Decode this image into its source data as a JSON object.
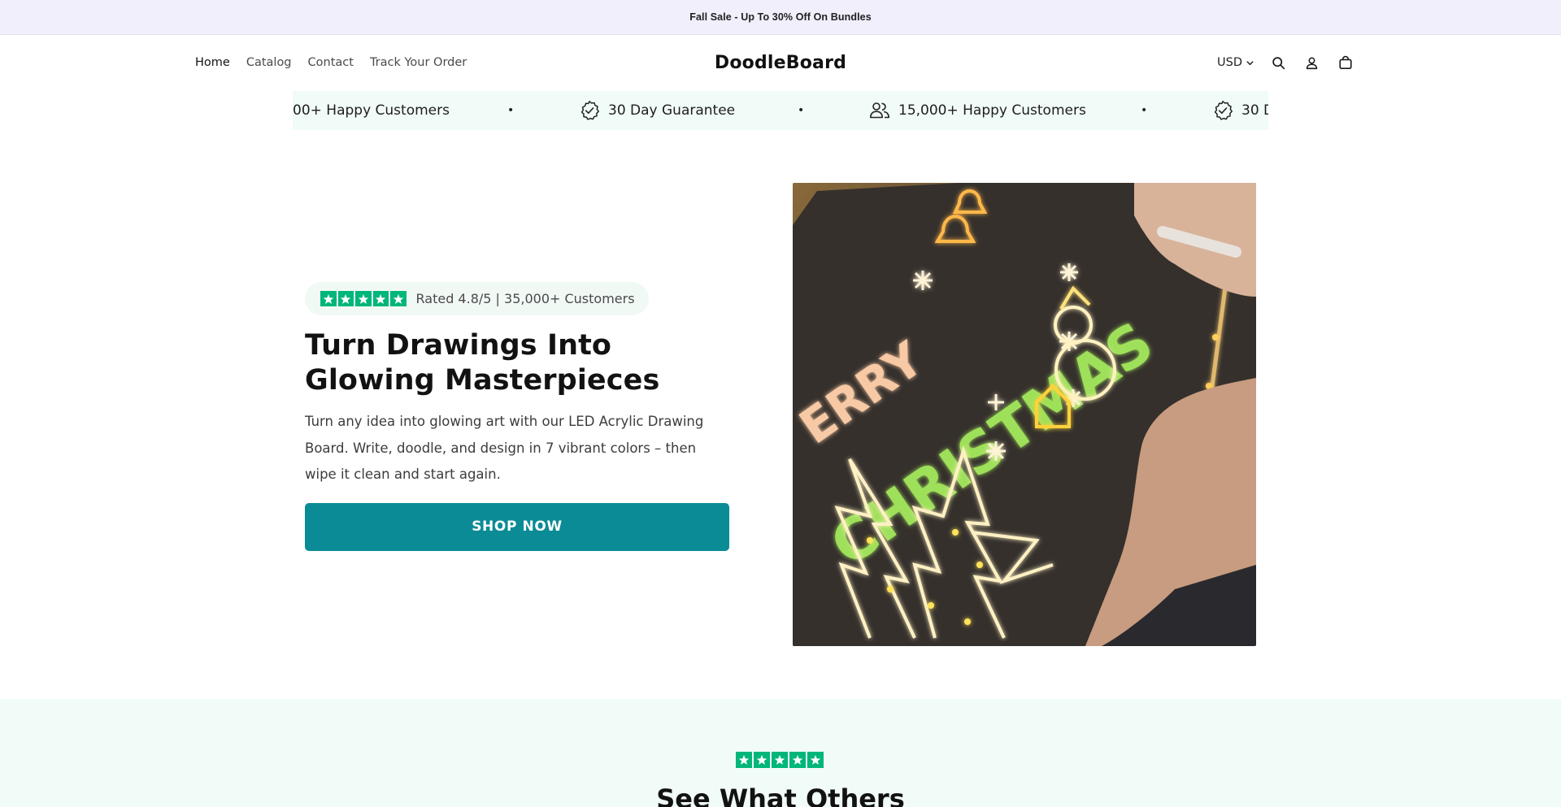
{
  "announcement": {
    "text": "Fall Sale - Up To 30% Off On Bundles"
  },
  "nav": {
    "home": "Home",
    "catalog": "Catalog",
    "contact": "Contact",
    "track": "Track Your Order"
  },
  "brand": {
    "name": "DoodleBoard"
  },
  "header_tools": {
    "currency": "USD",
    "search_icon": "search-icon",
    "account_icon": "user-icon",
    "cart_icon": "shopping-bag-icon"
  },
  "trust_bar": {
    "items": [
      {
        "text": "00+ Happy Customers",
        "icon": "people-icon"
      },
      {
        "text": "30 Day Guarantee",
        "icon": "badge-check-icon"
      },
      {
        "text": "15,000+ Happy Customers",
        "icon": "people-icon"
      },
      {
        "text": "30 D",
        "icon": "badge-check-icon"
      }
    ],
    "separator": "•"
  },
  "hero": {
    "rating_text": "Rated 4.8/5 | 35,000+ Customers",
    "rating_stars": 5,
    "title": "Turn Drawings Into Glowing Masterpieces",
    "description": "Turn any idea into glowing art with our LED Acrylic Drawing Board. Write, doodle, and design in 7 vibrant colors – then wipe it clean and start again.",
    "cta": "SHOP NOW",
    "image_text": [
      "ERRY",
      "CHRISTMAS"
    ]
  },
  "reviews_section": {
    "stars": 5,
    "heading": "See What Others"
  },
  "colors": {
    "announcement_bg": "#f1effb",
    "trust_bg": "#f1fbf8",
    "cta": "#0b8b95",
    "star_green": "#00b67a"
  }
}
